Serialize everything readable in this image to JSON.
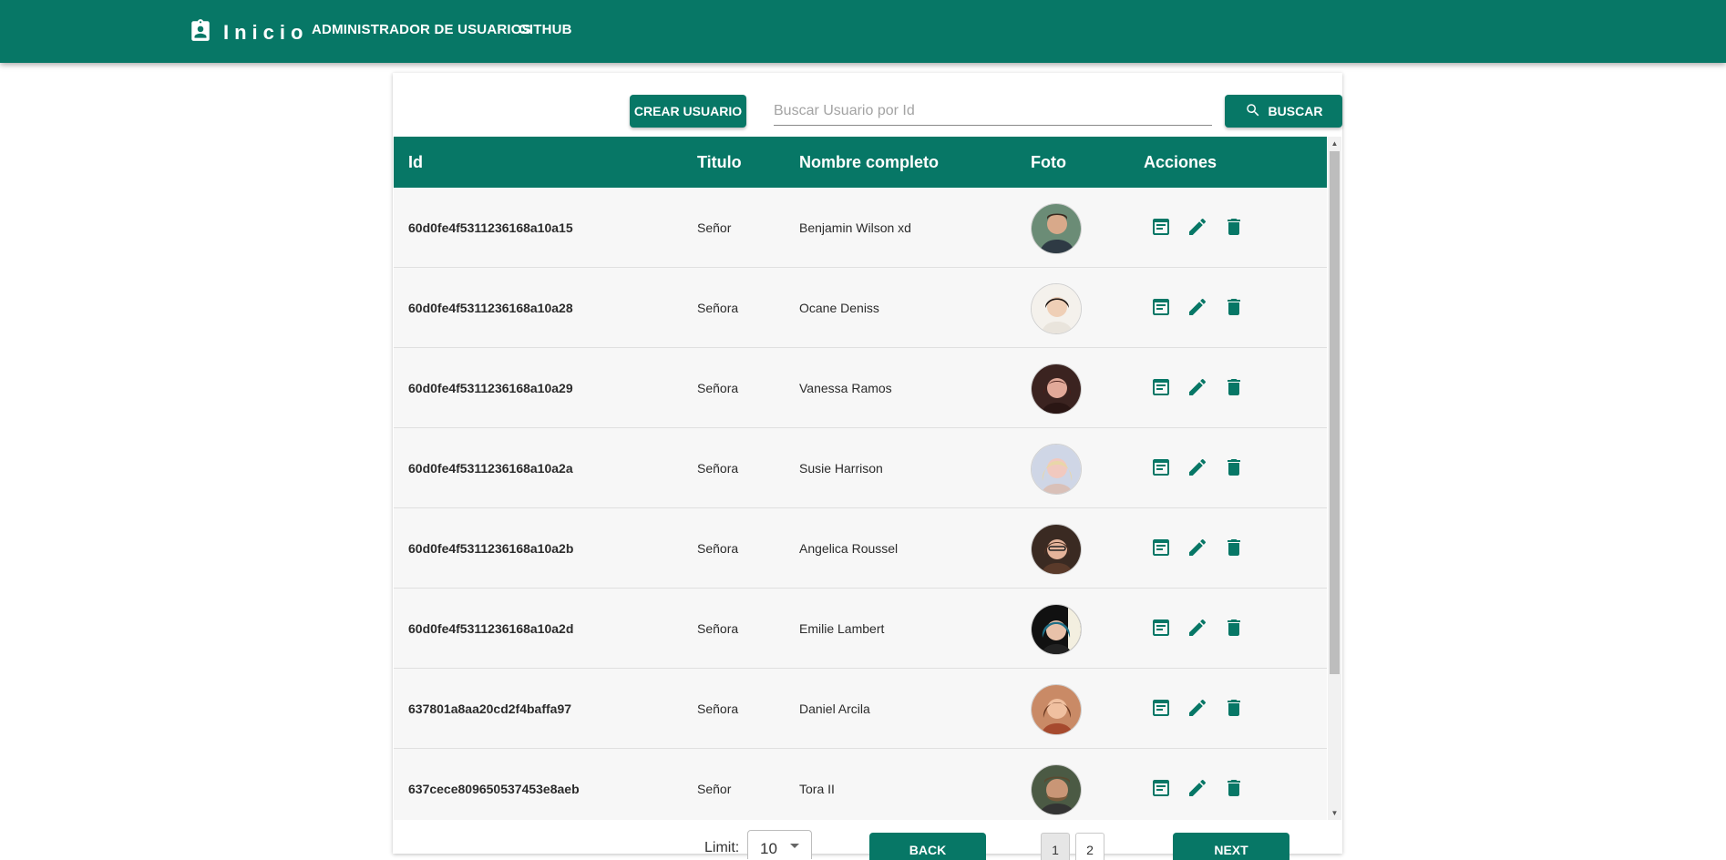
{
  "nav": {
    "brand": "Inicio",
    "links": [
      "ADMINISTRADOR DE USUARIOS",
      "GITHUB"
    ]
  },
  "toolbar": {
    "create_label": "CREAR USUARIO",
    "search_placeholder": "Buscar Usuario por Id",
    "search_value": "",
    "search_label": "BUSCAR"
  },
  "table": {
    "headers": [
      "Id",
      "Titulo",
      "Nombre completo",
      "Foto",
      "Acciones"
    ],
    "rows": [
      {
        "id": "60d0fe4f5311236168a10a15",
        "title": "Señor",
        "name": "Benjamin Wilson xd"
      },
      {
        "id": "60d0fe4f5311236168a10a28",
        "title": "Señora",
        "name": "Ocane Deniss"
      },
      {
        "id": "60d0fe4f5311236168a10a29",
        "title": "Señora",
        "name": "Vanessa Ramos"
      },
      {
        "id": "60d0fe4f5311236168a10a2a",
        "title": "Señora",
        "name": "Susie Harrison"
      },
      {
        "id": "60d0fe4f5311236168a10a2b",
        "title": "Señora",
        "name": "Angelica Roussel"
      },
      {
        "id": "60d0fe4f5311236168a10a2d",
        "title": "Señora",
        "name": "Emilie Lambert"
      },
      {
        "id": "637801a8aa20cd2f4baffa97",
        "title": "Señora",
        "name": "Daniel Arcila"
      },
      {
        "id": "637cece809650537453e8aeb",
        "title": "Señor",
        "name": "Tora II"
      }
    ]
  },
  "pager": {
    "limit_label": "Limit:",
    "limit_value": "10",
    "back_label": "BACK",
    "next_label": "NEXT",
    "pages": [
      "1",
      "2"
    ],
    "current_page": "1"
  },
  "colors": {
    "primary": "#077766",
    "row_bg": "#f7f7f7"
  },
  "icons": {
    "brand": "contact-badge-icon",
    "search": "search-icon",
    "actions": [
      "details-icon",
      "edit-pencil-icon",
      "delete-trash-icon"
    ]
  }
}
